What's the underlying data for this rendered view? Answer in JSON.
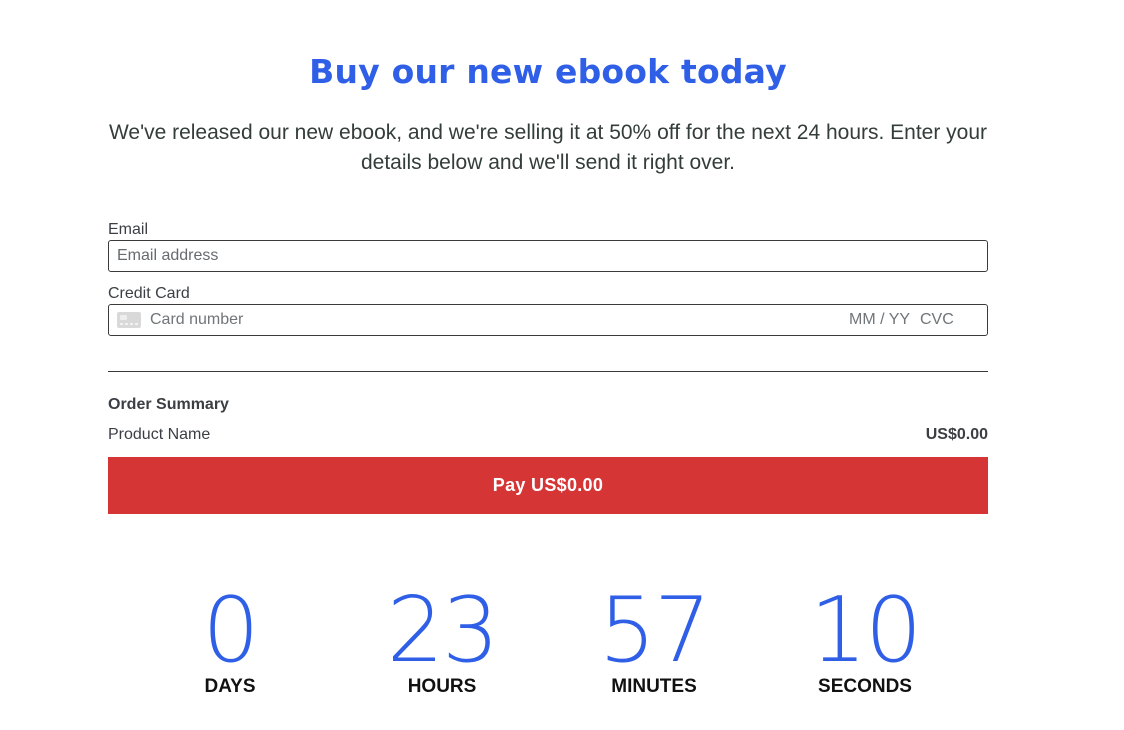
{
  "header": {
    "title": "Buy our new ebook today",
    "subtitle": "We've released our new ebook, and we're selling it at 50% off for the next 24 hours. Enter your details below and we'll send it right over."
  },
  "form": {
    "email_label": "Email",
    "email_placeholder": "Email address",
    "card_label": "Credit Card",
    "card_number_placeholder": "Card number",
    "card_expiry_placeholder": "MM / YY",
    "card_cvc_placeholder": "CVC"
  },
  "order_summary": {
    "title": "Order Summary",
    "product_name": "Product Name",
    "product_price": "US$0.00"
  },
  "pay_button_label": "Pay US$0.00",
  "countdown": {
    "days": {
      "value": "0",
      "label": "DAYS"
    },
    "hours": {
      "value": "23",
      "label": "HOURS"
    },
    "minutes": {
      "value": "57",
      "label": "MINUTES"
    },
    "seconds": {
      "value": "10",
      "label": "SECONDS"
    }
  },
  "colors": {
    "accent_blue": "#2f5fe6",
    "pay_red": "#d63535"
  },
  "icons": {
    "card": "credit-card-icon"
  }
}
